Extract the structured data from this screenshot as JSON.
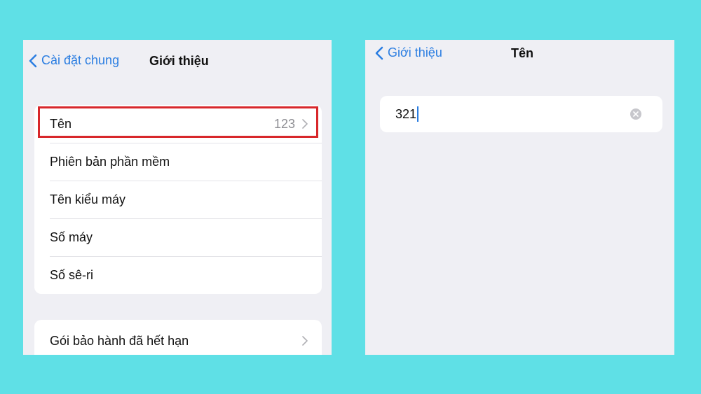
{
  "left": {
    "back_label": "Cài đặt chung",
    "title": "Giới thiệu",
    "rows": [
      {
        "label": "Tên",
        "value": "123"
      },
      {
        "label": "Phiên bản phần mềm"
      },
      {
        "label": "Tên kiểu máy"
      },
      {
        "label": "Số máy"
      },
      {
        "label": "Số sê-ri"
      }
    ],
    "warranty_label": "Gói bảo hành đã hết hạn",
    "highlight_color": "#d8272b"
  },
  "right": {
    "back_label": "Giới thiệu",
    "title": "Tên",
    "name_value": "321"
  },
  "colors": {
    "background": "#5fe0e6",
    "accent": "#2a7de1"
  }
}
